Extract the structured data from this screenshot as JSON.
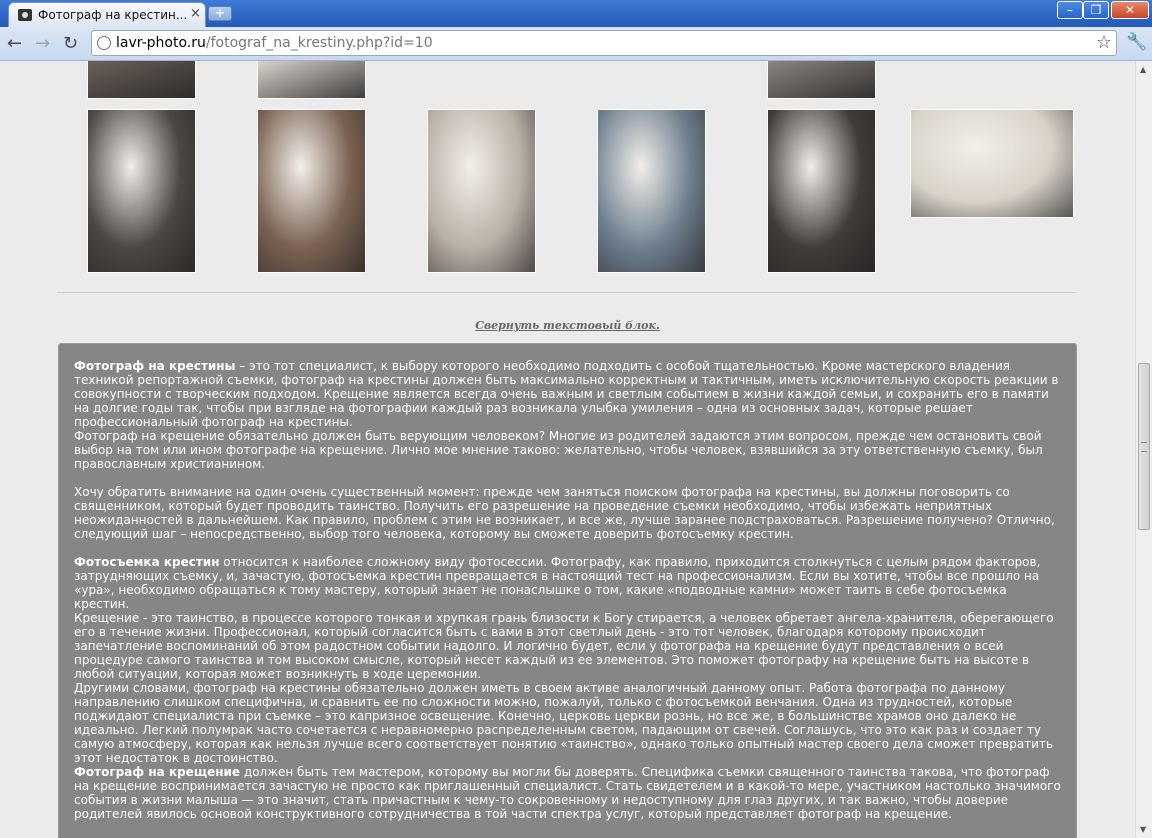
{
  "browser": {
    "tab_title": "Фотограф на крестин...",
    "tab_close": "×",
    "new_tab": "+",
    "url_host": "lavr-photo.ru",
    "url_path": "/fotograf_na_krestiny.php?id=10",
    "win_min": "–",
    "win_max": "❐",
    "win_close": "✕",
    "back": "←",
    "forward": "→",
    "reload": "↻",
    "star": "☆",
    "wrench": "🔧"
  },
  "gallery": {
    "top_row_colors": [
      "#6a6058",
      "#d9d2cc",
      "#8c8580"
    ],
    "main_row_colors": [
      "#4a4744",
      "#7a6252",
      "#b9b0a6",
      "#6f7f8f",
      "#3f3c3a",
      "#d8d2c8"
    ]
  },
  "content": {
    "collapse_link": "Свернуть текстовый блок.",
    "p1_bold": "Фотограф на крестины",
    "p1_rest": " – это тот специалист, к выбору которого необходимо подходить с особой тщательностью. Кроме мастерского владения техникой репортажной съемки, фотограф на крестины должен быть максимально корректным и тактичным, иметь исключительную скорость реакции в совокупности с творческим подходом. Крещение является всегда очень важным и светлым  событием в жизни каждой семьи, и сохранить его в памяти на долгие годы так, чтобы при взгляде на фотографии каждый раз возникала улыбка умиления – одна из основных задач, которые решает профессиональный фотограф на крестины.",
    "p2": "Фотограф на крещение обязательно должен быть верующим человеком? Многие из родителей задаются этим вопросом, прежде чем остановить свой выбор на том или ином фотографе на крещение. Лично мое мнение таково: желательно, чтобы человек, взявшийся за эту ответственную съемку, был православным христианином.",
    "p3": "Хочу обратить внимание на один очень существенный момент: прежде чем заняться поиском фотографа на крестины, вы должны поговорить со священником, который будет проводить таинство. Получить его разрешение на проведение съемки  необходимо, чтобы избежать неприятных неожиданностей в дальнейшем. Как правило, проблем с этим не возникает, и все же, лучше заранее подстраховаться. Разрешение получено? Отлично, следующий шаг – непосредственно, выбор того человека, которому вы сможете доверить фотосъемку крестин.",
    "p4_bold": "Фотосъемка крестин",
    "p4_rest": " относится к наиболее сложному виду фотосессии. Фотографу, как правило, приходится столкнуться с целым рядом факторов, затрудняющих съемку, и, зачастую, фотосъемка крестин превращается в настоящий тест на профессионализм. Если вы хотите, чтобы все прошло на «ура», необходимо обращаться к тому мастеру, который знает не понаслышке о том, какие «подводные камни» может таить в себе фотосъемка крестин.",
    "p5": "Крещение - это таинство, в процессе которого тонкая и хрупкая грань близости к Богу стирается, а человек обретает ангела-хранителя, оберегающего его в течение жизни. Профессионал, который согласится быть с вами в этот светлый день - это тот человек, благодаря которому происходит запечатление воспоминаний об этом радостном событии надолго. И логично будет, если у фотографа на крещение будут представления о  всей процедуре самого таинства и том высоком смысле, который несет каждый из ее элементов. Это поможет фотографу на крещение быть на высоте в любой ситуации, которая может возникнуть в ходе церемонии.",
    "p6": "Другими словами, фотограф на крестины обязательно должен иметь в своем активе аналогичный данному опыт. Работа фотографа по данному направлению слишком специфична, и сравнить ее по сложности можно, пожалуй, только с фотосъемкой венчания. Одна из трудностей, которые поджидают специалиста при съемке  – это капризное освещение. Конечно, церковь церкви рознь, но все же, в большинстве храмов оно далеко не идеально. Легкий полумрак часто сочетается с неравномерно распределенным светом, падающим от свечей. Соглашусь, что это как раз и создает ту самую атмосферу, которая как нельзя лучше всего соответствует понятию «таинство», однако только опытный мастер своего дела сможет превратить этот недостаток в достоинство.",
    "p7_bold": "Фотограф на крещение",
    "p7_rest": " должен быть тем мастером, которому вы могли бы доверять. Специфика съемки священного таинства такова, что фотограф на крещение воспринимается зачастую не просто как приглашенный специалист. Стать свидетелем и в какой-то мере, участником настолько значимого события в жизни малыша — это значит, стать причастным к чему-то сокровенному и недоступному для глаз других, и так важно, чтобы доверие родителей явилось основой конструктивного сотрудничества в той части спектра услуг, который представляет фотограф на крещение."
  },
  "scrollbar": {
    "up": "▲",
    "down": "▼"
  }
}
